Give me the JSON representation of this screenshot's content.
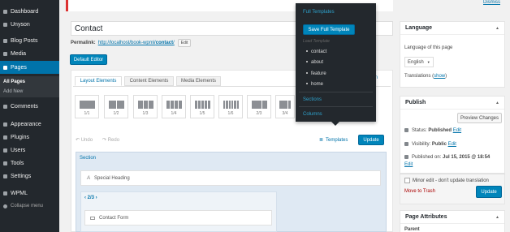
{
  "notice": {
    "dismiss": "Dismiss"
  },
  "sidebar": {
    "items": [
      {
        "label": "Dashboard",
        "icon": "dashboard-icon"
      },
      {
        "label": "Unyson",
        "icon": "unyson-icon"
      },
      {
        "label": "Blog Posts",
        "icon": "pin-icon"
      },
      {
        "label": "Media",
        "icon": "media-icon"
      },
      {
        "label": "Pages",
        "icon": "pages-icon"
      },
      {
        "label": "Comments",
        "icon": "comments-icon"
      },
      {
        "label": "Appearance",
        "icon": "appearance-icon"
      },
      {
        "label": "Plugins",
        "icon": "plugins-icon"
      },
      {
        "label": "Users",
        "icon": "users-icon"
      },
      {
        "label": "Tools",
        "icon": "tools-icon"
      },
      {
        "label": "Settings",
        "icon": "settings-icon"
      },
      {
        "label": "WPML",
        "icon": "wpml-icon"
      },
      {
        "label": "Collapse menu",
        "icon": "collapse-icon"
      }
    ],
    "sub": {
      "all_pages": "All Pages",
      "add_new": "Add New"
    }
  },
  "editor": {
    "title": "Contact",
    "permalink_label": "Permalink:",
    "permalink_base": "http://localhost/book-wpml/",
    "permalink_slug": "contact",
    "permalink_end": "/",
    "edit": "Edit",
    "default_editor": "Default Editor",
    "tabs": [
      "Layout Elements",
      "Content Elements",
      "Media Elements"
    ],
    "open_link": "pen",
    "columns": [
      "1/1",
      "1/2",
      "1/3",
      "1/4",
      "1/5",
      "1/6",
      "2/3",
      "3/4"
    ],
    "undo": "↶ Undo",
    "redo": "↷ Redo",
    "templates": "Templates",
    "update": "Update",
    "section": "Section",
    "special_heading": "Special Heading",
    "col_nav": "‹ 2/3 ›",
    "contact_form": "Contact Form"
  },
  "dropdown": {
    "full_templates": "Full Templates",
    "save_full_template": "Save Full Template",
    "load_template": "Load Template",
    "templates": [
      "contact",
      "about",
      "feature",
      "home"
    ],
    "sections": "Sections",
    "columns": "Columns"
  },
  "language": {
    "title": "Language",
    "lang_of_page": "Language of this page",
    "selected": "English",
    "translations": "Translations (",
    "show": "show",
    "close_paren": ")"
  },
  "publish": {
    "title": "Publish",
    "preview": "Preview Changes",
    "status_label": "Status:",
    "status_value": "Published",
    "visibility_label": "Visibility:",
    "visibility_value": "Public",
    "published_on_label": "Published on:",
    "published_on_value": "Jul 15, 2015 @ 18:54",
    "edit": "Edit",
    "minor_edit": "Minor edit - don't update translation",
    "trash": "Move to Trash",
    "update": "Update"
  },
  "page_attributes": {
    "title": "Page Attributes",
    "parent": "Parent"
  },
  "colors": {
    "admin_bar": "#23282d",
    "accent": "#0073aa",
    "primary_button": "#0085ba",
    "notice_error": "#dc3232"
  }
}
